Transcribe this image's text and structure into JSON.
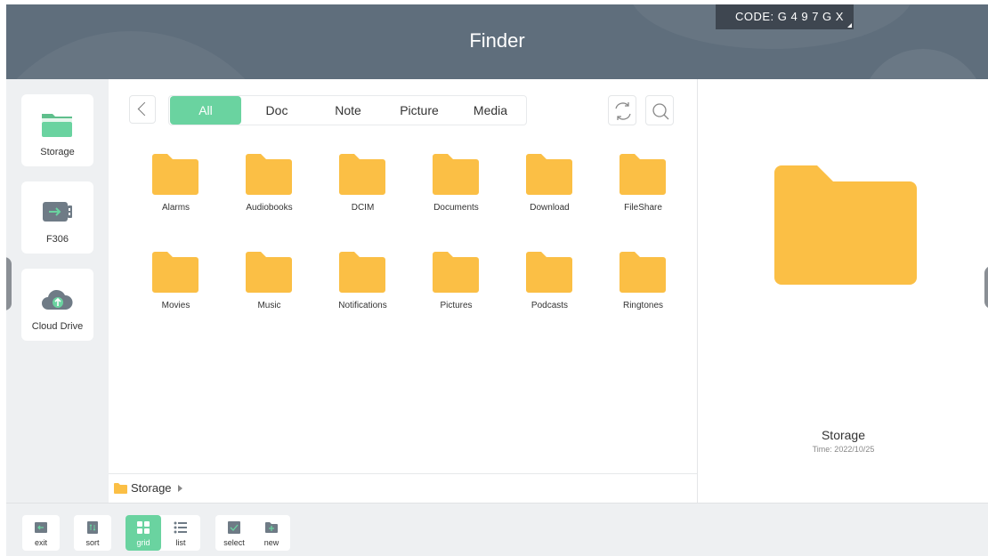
{
  "header": {
    "title": "Finder",
    "code": "CODE: G 4 9 7 G X"
  },
  "sidebar": {
    "devices": [
      {
        "label": "Storage",
        "icon": "storage-folder-icon"
      },
      {
        "label": "F306",
        "icon": "usb-drive-icon"
      },
      {
        "label": "Cloud Drive",
        "icon": "cloud-upload-icon"
      }
    ]
  },
  "tabs": [
    {
      "label": "All",
      "active": true
    },
    {
      "label": "Doc",
      "active": false
    },
    {
      "label": "Note",
      "active": false
    },
    {
      "label": "Picture",
      "active": false
    },
    {
      "label": "Media",
      "active": false
    }
  ],
  "folders": [
    "Alarms",
    "Audiobooks",
    "DCIM",
    "Documents",
    "Download",
    "FileShare",
    "Movies",
    "Music",
    "Notifications",
    "Pictures",
    "Podcasts",
    "Ringtones"
  ],
  "breadcrumb": {
    "label": "Storage"
  },
  "preview": {
    "name": "Storage",
    "time": "Time: 2022/10/25"
  },
  "toolbar": {
    "exit": "exit",
    "sort": "sort",
    "grid": "grid",
    "list": "list",
    "select": "select",
    "new": "new"
  },
  "colors": {
    "accent": "#6ad3a0",
    "folder": "#fbbf45",
    "header": "#5f6e7c",
    "icon_gray": "#6f7b86"
  }
}
